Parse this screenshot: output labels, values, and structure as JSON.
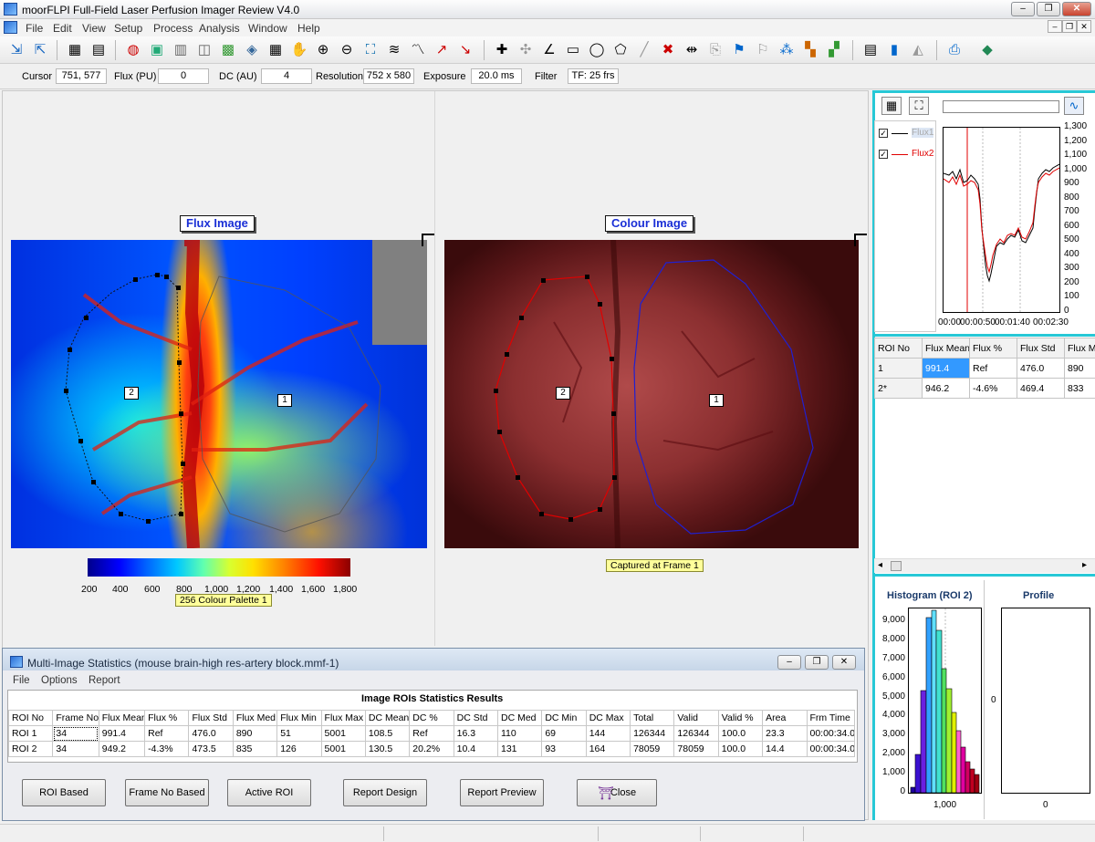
{
  "app": {
    "title": "moorFLPI Full-Field Laser Perfusion Imager Review V4.0",
    "min": "‒",
    "max": "❐",
    "close": "✕"
  },
  "menu": [
    "File",
    "Edit",
    "View",
    "Setup",
    "Process",
    "Analysis",
    "Window",
    "Help"
  ],
  "status": {
    "cursor_label": "Cursor",
    "cursor": "751, 577",
    "flux_label": "Flux (PU)",
    "flux": "0",
    "dc_label": "DC (AU)",
    "dc": "4",
    "res_label": "Resolution",
    "res": "752 x 580",
    "exp_label": "Exposure",
    "exp": "20.0 ms",
    "filter_label": "Filter",
    "filter": "TF: 25 frs"
  },
  "flux_image": {
    "title": "Flux Image",
    "palette_label": "256 Colour Palette 1",
    "ticks": [
      "200",
      "400",
      "600",
      "800",
      "1,000",
      "1,200",
      "1,400",
      "1,600",
      "1,800"
    ],
    "roi1": "1",
    "roi2": "2"
  },
  "colour_image": {
    "title": "Colour Image",
    "caption": "Captured at Frame 1",
    "roi1": "1",
    "roi2": "2"
  },
  "trace": {
    "legend": [
      {
        "name": "Flux1",
        "color": "#000000"
      },
      {
        "name": "Flux2",
        "color": "#e00000"
      }
    ],
    "y_ticks": [
      "1,300",
      "1,200",
      "1,100",
      "1,000",
      "900",
      "800",
      "700",
      "600",
      "500",
      "400",
      "300",
      "200",
      "100",
      "0"
    ],
    "x_ticks": [
      "00:00",
      "00:00:50",
      "00:01:40",
      "00:02:30"
    ]
  },
  "roi_table": {
    "headers": [
      "ROI No",
      "Flux Mean",
      "Flux %",
      "Flux Std",
      "Flux M"
    ],
    "rows": [
      [
        "1",
        "991.4",
        "Ref",
        "476.0",
        "890"
      ],
      [
        "2*",
        "946.2",
        "-4.6%",
        "469.4",
        "833"
      ]
    ]
  },
  "histogram": {
    "title": "Histogram (ROI 2)",
    "y_ticks": [
      "9,000",
      "8,000",
      "7,000",
      "6,000",
      "5,000",
      "4,000",
      "3,000",
      "2,000",
      "1,000",
      "0"
    ],
    "x_tick": "1,000"
  },
  "profile": {
    "title": "Profile",
    "y_tick": "0",
    "x_tick": "0"
  },
  "stats_window": {
    "title": "Multi-Image Statistics (mouse brain-high res-artery block.mmf-1)",
    "menu": [
      "File",
      "Options",
      "Report"
    ],
    "heading": "Image ROIs Statistics Results",
    "headers": [
      "ROI No",
      "Frame No",
      "Flux Mean",
      "Flux %",
      "Flux Std",
      "Flux Med",
      "Flux Min",
      "Flux Max",
      "DC Mean",
      "DC %",
      "DC Std",
      "DC Med",
      "DC Min",
      "DC Max",
      "Total",
      "Valid",
      "Valid %",
      "Area",
      "Frm Time"
    ],
    "rows": [
      [
        "ROI 1",
        "34",
        "991.4",
        "Ref",
        "476.0",
        "890",
        "51",
        "5001",
        "108.5",
        "Ref",
        "16.3",
        "110",
        "69",
        "144",
        "126344",
        "126344",
        "100.0",
        "23.3",
        "00:00:34.0"
      ],
      [
        "ROI 2",
        "34",
        "949.2",
        "-4.3%",
        "473.5",
        "835",
        "126",
        "5001",
        "130.5",
        "20.2%",
        "10.4",
        "131",
        "93",
        "164",
        "78059",
        "78059",
        "100.0",
        "14.4",
        "00:00:34.0"
      ]
    ],
    "buttons": [
      "ROI Based",
      "Frame No Based",
      "Active ROI",
      "Report Design",
      "Report Preview",
      "Close"
    ]
  }
}
